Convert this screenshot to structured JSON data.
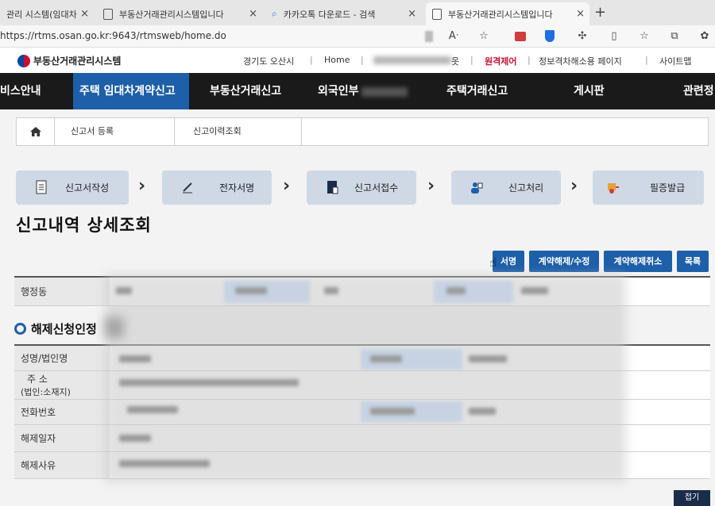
{
  "browser": {
    "tabs": [
      {
        "title": "관리 시스템(임대차",
        "icon": "doc-icon"
      },
      {
        "title": "부동산거래관리시스템입니다",
        "icon": "doc-icon"
      },
      {
        "title": "카카오톡 다운로드 - 검색",
        "icon": "search-icon"
      },
      {
        "title": "부동산거래관리시스템입니다",
        "icon": "doc-icon"
      }
    ],
    "new_tab": "+",
    "close": "×",
    "url": "https://rtms.osan.go.kr:9643/rtmsweb/home.do",
    "toolbar_icons": [
      "read-aloud-icon",
      "favorite-star-icon",
      "extension-icon",
      "shield-extension-icon",
      "puzzle-icon",
      "split-screen-icon",
      "favorites-list-icon",
      "collections-icon",
      "copilot-icon"
    ]
  },
  "site": {
    "logo_text": "부동산거래관리시스템",
    "util": {
      "region": "경기도 오산시",
      "home": "Home",
      "user_suffix": "옷",
      "remote": "원격제어",
      "info_page": "정보격차해소용 페이지",
      "sitemap": "사이트맵",
      "separator": "|"
    },
    "nav": {
      "item0": "비스안내",
      "item1": "주택 임대차계약신고",
      "item2": "부동산거래신고",
      "item3": "외국인부",
      "item4": "주택거래신고",
      "item5": "게시판",
      "item6": "관련정"
    },
    "accent": "#1d5fa8"
  },
  "breadcrumb": {
    "home_icon": "home-icon",
    "item1": "신고서 등록",
    "item2": "신고이력조회"
  },
  "steps": {
    "step1": "신고서작성",
    "step2": "전자서명",
    "step3": "신고서접수",
    "step4": "신고처리",
    "step5": "필증발급",
    "arrow": "›"
  },
  "page": {
    "title": "신고내역 상세조회"
  },
  "actions": {
    "sign": "서명",
    "cancel_edit": "계약해제/수정",
    "cancel_revoke": "계약해제취소",
    "list": "목록"
  },
  "info_row": {
    "label": "행정동"
  },
  "section": {
    "title": "해제신청인정"
  },
  "table": {
    "name": "성명/법인명",
    "address_line1": "주 소",
    "address_line2": "(법인:소재지)",
    "phone": "전화번호",
    "cancel_date": "해제일자",
    "cancel_reason": "해제사유"
  },
  "footer": {
    "button": "접기"
  }
}
